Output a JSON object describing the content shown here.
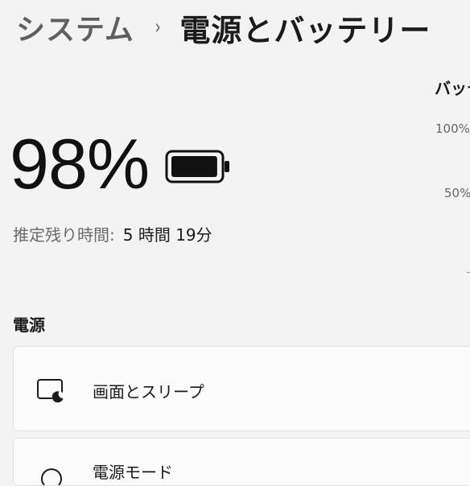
{
  "breadcrumb": {
    "parent": "システム",
    "separator": "›",
    "current": "電源とバッテリー"
  },
  "battery": {
    "percent": "98%",
    "level": 0.98,
    "estimate_label": "推定残り時間:",
    "estimate_value": "5 時間 19分"
  },
  "chart": {
    "title": "バッテリー",
    "tick_100": "100%",
    "tick_50": "50%"
  },
  "power_section": {
    "title": "電源",
    "items": [
      {
        "label": "画面とスリープ",
        "icon": "screen-sleep-icon"
      },
      {
        "label": "電源モード",
        "icon": "power-mode-icon"
      }
    ]
  }
}
